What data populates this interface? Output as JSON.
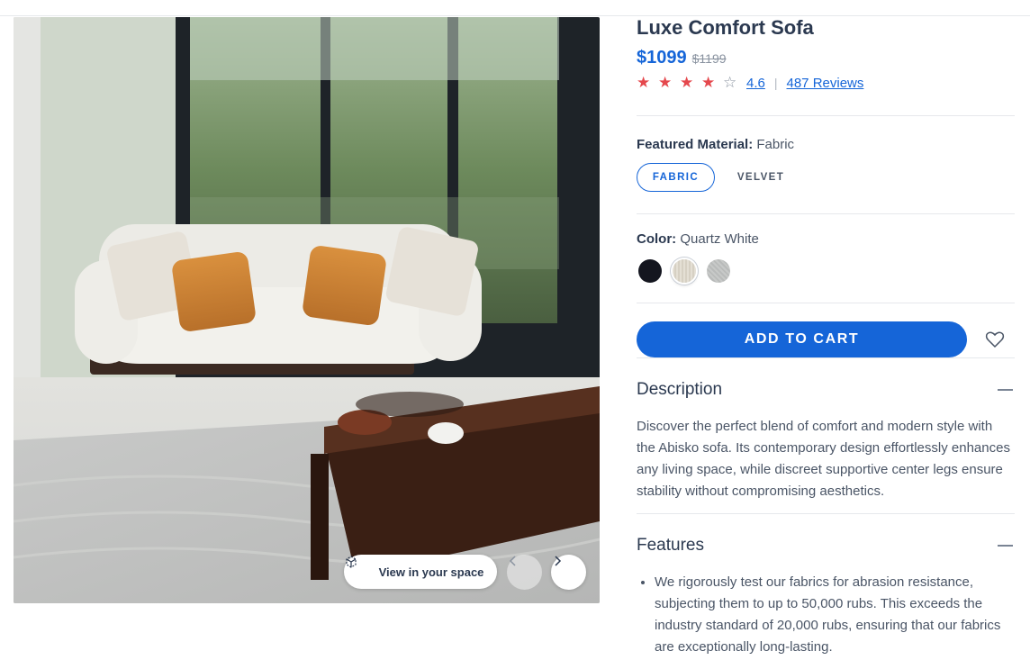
{
  "product": {
    "title": "Luxe Comfort Sofa",
    "price": "$1099",
    "original_price": "$1199",
    "rating": 4.6,
    "rating_text": "4.6",
    "rating_max": 5,
    "reviews_text": "487 Reviews"
  },
  "gallery": {
    "view_in_space_label": "View in your space",
    "view_in_space_icon": "ar-cube-icon",
    "prev_icon": "chevron-left-icon",
    "next_icon": "chevron-right-icon"
  },
  "material": {
    "label": "Featured Material:",
    "selected": "Fabric",
    "options": [
      "FABRIC",
      "VELVET"
    ]
  },
  "color": {
    "label": "Color:",
    "selected": "Quartz White",
    "swatches": [
      {
        "name": "navy",
        "hex": "#14161f"
      },
      {
        "name": "quartz-white",
        "hex": "#e4dfd4"
      },
      {
        "name": "grey",
        "hex": "#c7c9c8"
      }
    ]
  },
  "actions": {
    "add_to_cart": "ADD TO CART",
    "wishlist_icon": "heart-icon"
  },
  "description": {
    "heading": "Description",
    "body": "Discover the perfect blend of comfort and modern style with the Abisko sofa. Its contemporary design effortlessly enhances any living space, while discreet supportive center legs ensure stability without compromising aesthetics."
  },
  "features": {
    "heading": "Features",
    "items": [
      "We rigorously test our fabrics for abrasion resistance, subjecting them to up to 50,000 rubs. This exceeds the industry standard of 20,000 rubs, ensuring that our fabrics are exceptionally long-lasting."
    ]
  },
  "colors": {
    "accent": "#1565d8",
    "star": "#e5484d",
    "text": "#2b3950"
  }
}
